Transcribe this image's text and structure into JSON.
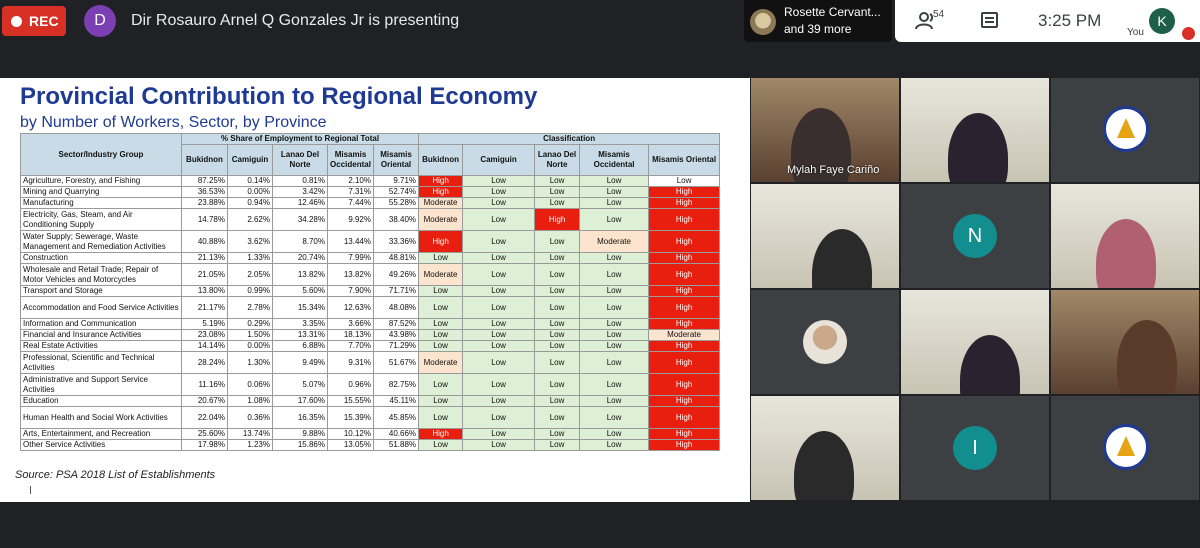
{
  "header": {
    "rec_label": "REC",
    "presenter_initial": "D",
    "presenter_text": "Dir Rosauro Arnel Q Gonzales Jr is presenting",
    "speaker_name": "Rosette Cervant...",
    "speaker_more": "and 39 more",
    "people_count": "54",
    "time": "3:25 PM",
    "you_initial": "K",
    "you_label": "You",
    "icons": [
      "record-dot-icon",
      "people-icon",
      "chat-icon",
      "mic-off-icon"
    ]
  },
  "slide": {
    "title": "Provincial Contribution to Regional Economy",
    "subtitle": "by Number of Workers, Sector, by Province",
    "group_share": "% Share of Employment to Regional Total",
    "group_class": "Classification",
    "col_sector": "Sector/Industry Group",
    "share_cols": [
      "Bukidnon",
      "Camiguin",
      "Lanao Del Norte",
      "Misamis Occidental",
      "Misamis Oriental"
    ],
    "class_cols": [
      "Bukidnon",
      "Camiguin",
      "Lanao Del Norte",
      "Misamis Occidental",
      "Misamis Oriental"
    ],
    "rows": [
      {
        "sector": "Agriculture, Forestry, and Fishing",
        "shares": [
          "87.25%",
          "0.14%",
          "0.81%",
          "2.10%",
          "9.71%"
        ],
        "classes": [
          "High",
          "Low",
          "Low",
          "Low",
          "Low"
        ]
      },
      {
        "sector": "Mining and Quarrying",
        "shares": [
          "36.53%",
          "0.00%",
          "3.42%",
          "7.31%",
          "52.74%"
        ],
        "classes": [
          "High",
          "Low",
          "Low",
          "Low",
          "High"
        ]
      },
      {
        "sector": "Manufacturing",
        "shares": [
          "23.88%",
          "0.94%",
          "12.46%",
          "7.44%",
          "55.28%"
        ],
        "classes": [
          "Moderate",
          "Low",
          "Low",
          "Low",
          "High"
        ]
      },
      {
        "sector": "Electricity, Gas, Steam, and Air Conditioning Supply",
        "shares": [
          "14.78%",
          "2.62%",
          "34.28%",
          "9.92%",
          "38.40%"
        ],
        "classes": [
          "Moderate",
          "Low",
          "High",
          "Low",
          "High"
        ]
      },
      {
        "sector": "Water Supply; Sewerage, Waste Management and Remediation Activities",
        "shares": [
          "40.88%",
          "3.62%",
          "8.70%",
          "13.44%",
          "33.36%"
        ],
        "classes": [
          "High",
          "Low",
          "Low",
          "Moderate",
          "High"
        ]
      },
      {
        "sector": "Construction",
        "shares": [
          "21.13%",
          "1.33%",
          "20.74%",
          "7.99%",
          "48.81%"
        ],
        "classes": [
          "Low",
          "Low",
          "Low",
          "Low",
          "High"
        ]
      },
      {
        "sector": "Wholesale and Retail Trade; Repair of Motor Vehicles and Motorcycles",
        "shares": [
          "21.05%",
          "2.05%",
          "13.82%",
          "13.82%",
          "49.26%"
        ],
        "classes": [
          "Moderate",
          "Low",
          "Low",
          "Low",
          "High"
        ]
      },
      {
        "sector": "Transport and Storage",
        "shares": [
          "13.80%",
          "0.99%",
          "5.60%",
          "7.90%",
          "71.71%"
        ],
        "classes": [
          "Low",
          "Low",
          "Low",
          "Low",
          "High"
        ]
      },
      {
        "sector": "Accommodation and Food Service Activities",
        "shares": [
          "21.17%",
          "2.78%",
          "15.34%",
          "12.63%",
          "48.08%"
        ],
        "classes": [
          "Low",
          "Low",
          "Low",
          "Low",
          "High"
        ]
      },
      {
        "sector": "Information and Communication",
        "shares": [
          "5.19%",
          "0.29%",
          "3.35%",
          "3.66%",
          "87.52%"
        ],
        "classes": [
          "Low",
          "Low",
          "Low",
          "Low",
          "High"
        ]
      },
      {
        "sector": "Financial and Insurance Activities",
        "shares": [
          "23.08%",
          "1.50%",
          "13.31%",
          "18.13%",
          "43.98%"
        ],
        "classes": [
          "Low",
          "Low",
          "Low",
          "Low",
          "Moderate"
        ]
      },
      {
        "sector": "Real Estate Activities",
        "shares": [
          "14.14%",
          "0.00%",
          "6.88%",
          "7.70%",
          "71.29%"
        ],
        "classes": [
          "Low",
          "Low",
          "Low",
          "Low",
          "High"
        ]
      },
      {
        "sector": "Professional, Scientific and Technical Activities",
        "shares": [
          "28.24%",
          "1.30%",
          "9.49%",
          "9.31%",
          "51.67%"
        ],
        "classes": [
          "Moderate",
          "Low",
          "Low",
          "Low",
          "High"
        ]
      },
      {
        "sector": "Administrative and Support Service Activities",
        "shares": [
          "11.16%",
          "0.06%",
          "5.07%",
          "0.96%",
          "82.75%"
        ],
        "classes": [
          "Low",
          "Low",
          "Low",
          "Low",
          "High"
        ]
      },
      {
        "sector": "Education",
        "shares": [
          "20.67%",
          "1.08%",
          "17.60%",
          "15.55%",
          "45.11%"
        ],
        "classes": [
          "Low",
          "Low",
          "Low",
          "Low",
          "High"
        ]
      },
      {
        "sector": "Human Health and Social Work Activities",
        "shares": [
          "22.04%",
          "0.36%",
          "16.35%",
          "15.39%",
          "45.85%"
        ],
        "classes": [
          "Low",
          "Low",
          "Low",
          "Low",
          "High"
        ]
      },
      {
        "sector": "Arts, Entertainment, and Recreation",
        "shares": [
          "25.60%",
          "13.74%",
          "9.88%",
          "10.12%",
          "40.66%"
        ],
        "classes": [
          "High",
          "Low",
          "Low",
          "Low",
          "High"
        ]
      },
      {
        "sector": "Other Service Activities",
        "shares": [
          "17.98%",
          "1.23%",
          "15.86%",
          "13.05%",
          "51.88%"
        ],
        "classes": [
          "Low",
          "Low",
          "Low",
          "Low",
          "High"
        ]
      }
    ],
    "source": "Source: PSA 2018 List of Establishments"
  },
  "participants": [
    {
      "name": "Mylah Faye Cariño",
      "kind": "video"
    },
    {
      "name": "",
      "kind": "video"
    },
    {
      "name": "",
      "kind": "logo"
    },
    {
      "name": "",
      "kind": "video"
    },
    {
      "name": "",
      "kind": "initial",
      "initial": "N",
      "color": "#128e8e"
    },
    {
      "name": "",
      "kind": "video"
    },
    {
      "name": "",
      "kind": "avatar"
    },
    {
      "name": "",
      "kind": "video"
    },
    {
      "name": "",
      "kind": "video"
    },
    {
      "name": "",
      "kind": "video"
    },
    {
      "name": "",
      "kind": "initial",
      "initial": "I",
      "color": "#128e8e"
    },
    {
      "name": "",
      "kind": "logo"
    }
  ],
  "colors": {
    "high": "#e81e0e",
    "moderate": "#fde4cf",
    "low": "#ddefd4",
    "header": "#c8dbe6",
    "title": "#1f3a93",
    "rec": "#d93025"
  }
}
